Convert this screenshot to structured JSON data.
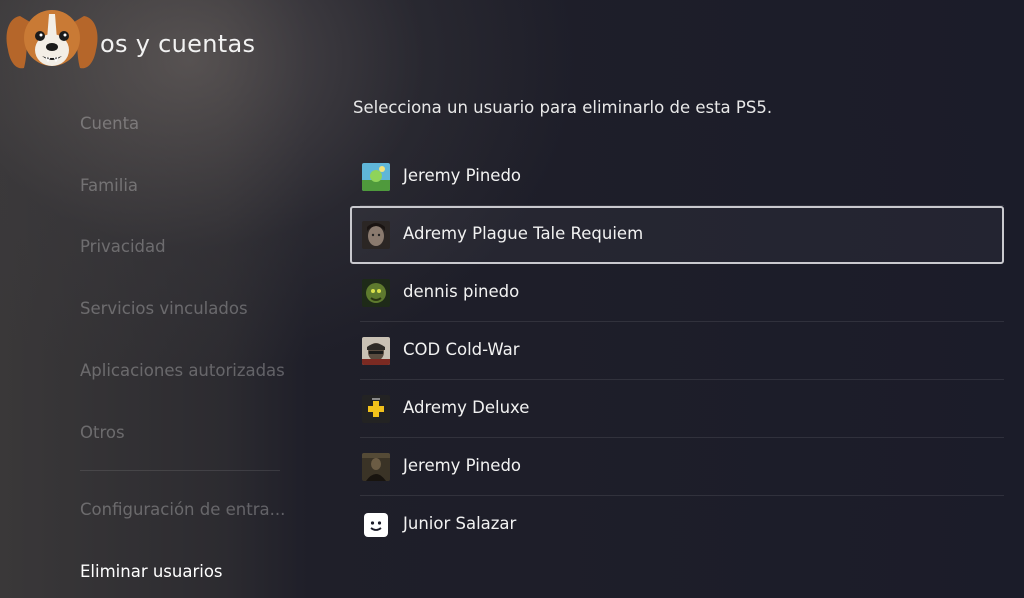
{
  "header": {
    "title": "os y cuentas",
    "mascot_icon": "dog-mascot-icon"
  },
  "sidebar": {
    "items": [
      {
        "label": "Cuenta"
      },
      {
        "label": "Familia"
      },
      {
        "label": "Privacidad"
      },
      {
        "label": "Servicios vinculados"
      },
      {
        "label": "Aplicaciones autorizadas"
      },
      {
        "label": "Otros"
      },
      {
        "label": "Configuración de entra..."
      },
      {
        "label": "Eliminar usuarios",
        "active": true
      }
    ]
  },
  "main": {
    "instruction": "Selecciona un usuario para eliminarlo de esta PS5.",
    "users": [
      {
        "name": "Jeremy Pinedo",
        "avatar": "landscape-avatar-icon"
      },
      {
        "name": "Adremy Plague Tale Requiem",
        "avatar": "portrait-avatar-icon",
        "focused": true
      },
      {
        "name": "dennis pinedo",
        "avatar": "creature-avatar-icon"
      },
      {
        "name": "COD Cold-War",
        "avatar": "soldier-avatar-icon"
      },
      {
        "name": "Adremy Deluxe",
        "avatar": "ps-plus-avatar-icon"
      },
      {
        "name": "Jeremy Pinedo",
        "avatar": "dark-figure-avatar-icon"
      },
      {
        "name": "Junior Salazar",
        "avatar": "default-face-avatar-icon"
      }
    ]
  },
  "colors": {
    "focus_border": "#c9c9ce",
    "background": "#1b1c29"
  }
}
